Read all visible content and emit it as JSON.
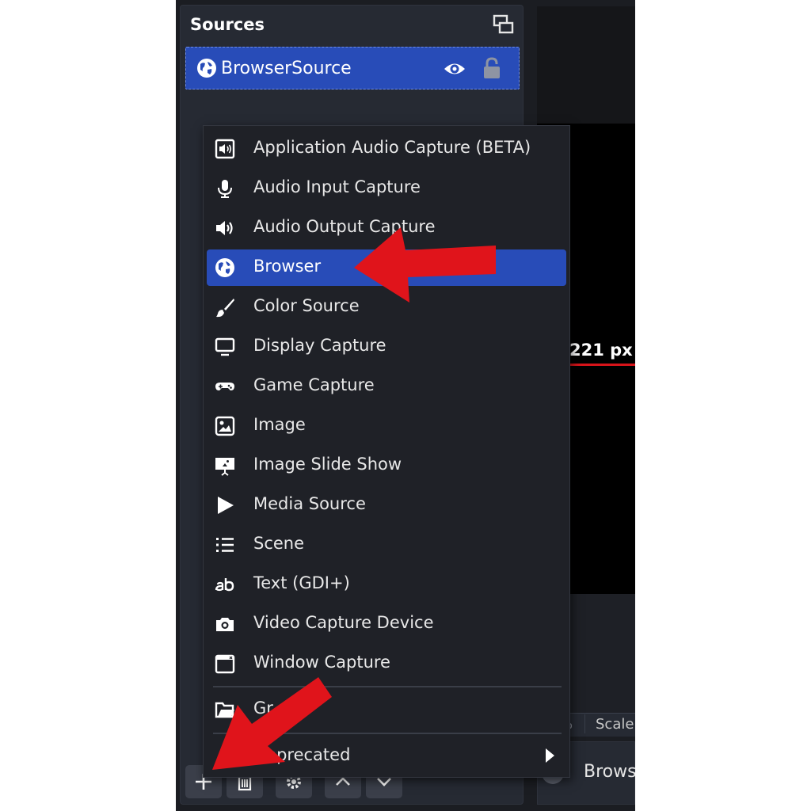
{
  "sources_dock": {
    "title": "Sources",
    "items": [
      {
        "name": "BrowserSource",
        "visible": true,
        "locked": true
      }
    ]
  },
  "context_menu": {
    "items": [
      {
        "label": "Application Audio Capture (BETA)",
        "icon": "app-audio-icon"
      },
      {
        "label": "Audio Input Capture",
        "icon": "microphone-icon"
      },
      {
        "label": "Audio Output Capture",
        "icon": "speaker-icon"
      },
      {
        "label": "Browser",
        "icon": "globe-icon",
        "selected": true
      },
      {
        "label": "Color Source",
        "icon": "paintbrush-icon"
      },
      {
        "label": "Display Capture",
        "icon": "monitor-icon"
      },
      {
        "label": "Game Capture",
        "icon": "gamepad-icon"
      },
      {
        "label": "Image",
        "icon": "image-icon"
      },
      {
        "label": "Image Slide Show",
        "icon": "slideshow-icon"
      },
      {
        "label": "Media Source",
        "icon": "play-icon"
      },
      {
        "label": "Scene",
        "icon": "list-icon"
      },
      {
        "label": "Text (GDI+)",
        "icon": "text-icon"
      },
      {
        "label": "Video Capture Device",
        "icon": "camera-icon"
      },
      {
        "label": "Window Capture",
        "icon": "window-icon"
      }
    ],
    "group_label": "Gr",
    "deprecated_label": "Deprecated"
  },
  "preview": {
    "measure_label": "221 px",
    "status_zoom": "%",
    "status_scale": "Scale"
  },
  "properties": {
    "label": "Brows"
  },
  "colors": {
    "accent": "#284cb8",
    "annotation": "#e0141b",
    "menu_bg": "#1f2127",
    "dock_bg": "#262a33"
  }
}
